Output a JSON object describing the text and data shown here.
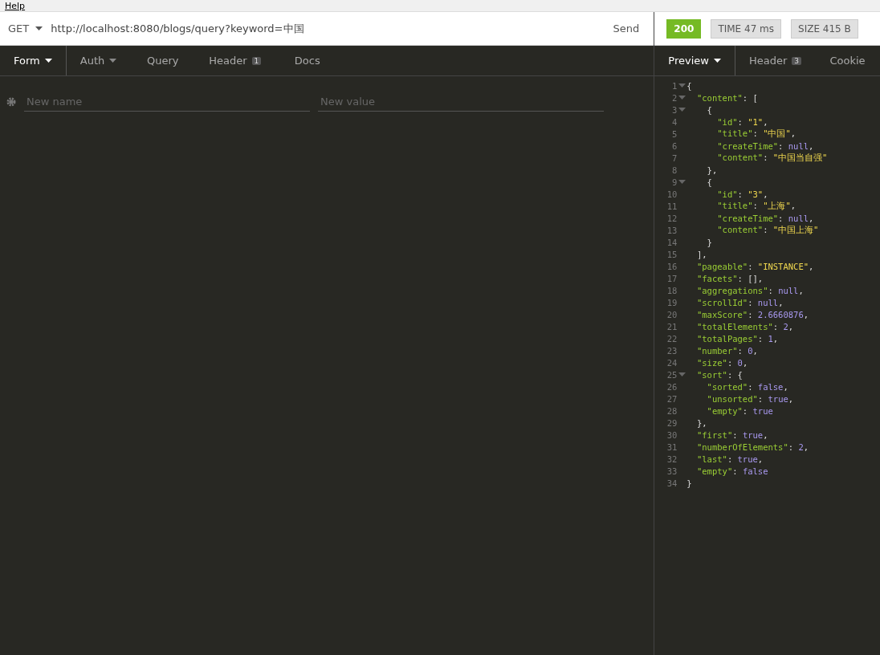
{
  "menu": {
    "label": "Help"
  },
  "request": {
    "method": "GET",
    "url": "http://localhost:8080/blogs/query?keyword=中国",
    "send": "Send"
  },
  "request_tabs": [
    {
      "label": "Form",
      "dropdown": true,
      "selected": true
    },
    {
      "label": "Auth",
      "dropdown": true,
      "selected": false
    },
    {
      "label": "Query",
      "dropdown": false,
      "selected": false
    },
    {
      "label": "Header",
      "dropdown": false,
      "badge": "1",
      "selected": false
    },
    {
      "label": "Docs",
      "dropdown": false,
      "selected": false
    }
  ],
  "form": {
    "name_placeholder": "New name",
    "value_placeholder": "New value"
  },
  "response": {
    "status": "200",
    "time": "TIME 47 ms",
    "size": "SIZE 415 B"
  },
  "response_tabs": [
    {
      "label": "Preview",
      "dropdown": true,
      "selected": true
    },
    {
      "label": "Header",
      "dropdown": false,
      "badge": "3",
      "selected": false
    },
    {
      "label": "Cookie",
      "dropdown": false,
      "selected": false
    }
  ],
  "code": [
    {
      "n": "1",
      "fold": true,
      "parts": [
        {
          "kind": "punct",
          "text": "{"
        }
      ]
    },
    {
      "n": "2",
      "fold": true,
      "parts": [
        {
          "kind": "key",
          "text": "  \"content\""
        },
        {
          "kind": "punct",
          "text": ": ["
        }
      ]
    },
    {
      "n": "3",
      "fold": true,
      "parts": [
        {
          "kind": "punct",
          "text": "    {"
        }
      ]
    },
    {
      "n": "4",
      "fold": false,
      "parts": [
        {
          "kind": "key",
          "text": "      \"id\""
        },
        {
          "kind": "punct",
          "text": ": "
        },
        {
          "kind": "string",
          "text": "\"1\""
        },
        {
          "kind": "punct",
          "text": ","
        }
      ]
    },
    {
      "n": "5",
      "fold": false,
      "parts": [
        {
          "kind": "key",
          "text": "      \"title\""
        },
        {
          "kind": "punct",
          "text": ": "
        },
        {
          "kind": "string",
          "text": "\"中国\""
        },
        {
          "kind": "punct",
          "text": ","
        }
      ]
    },
    {
      "n": "6",
      "fold": false,
      "parts": [
        {
          "kind": "key",
          "text": "      \"createTime\""
        },
        {
          "kind": "punct",
          "text": ": "
        },
        {
          "kind": "literal",
          "text": "null"
        },
        {
          "kind": "punct",
          "text": ","
        }
      ]
    },
    {
      "n": "7",
      "fold": false,
      "parts": [
        {
          "kind": "key",
          "text": "      \"content\""
        },
        {
          "kind": "punct",
          "text": ": "
        },
        {
          "kind": "string",
          "text": "\"中国当自强\""
        }
      ]
    },
    {
      "n": "8",
      "fold": false,
      "parts": [
        {
          "kind": "punct",
          "text": "    },"
        }
      ]
    },
    {
      "n": "9",
      "fold": true,
      "parts": [
        {
          "kind": "punct",
          "text": "    {"
        }
      ]
    },
    {
      "n": "10",
      "fold": false,
      "parts": [
        {
          "kind": "key",
          "text": "      \"id\""
        },
        {
          "kind": "punct",
          "text": ": "
        },
        {
          "kind": "string",
          "text": "\"3\""
        },
        {
          "kind": "punct",
          "text": ","
        }
      ]
    },
    {
      "n": "11",
      "fold": false,
      "parts": [
        {
          "kind": "key",
          "text": "      \"title\""
        },
        {
          "kind": "punct",
          "text": ": "
        },
        {
          "kind": "string",
          "text": "\"上海\""
        },
        {
          "kind": "punct",
          "text": ","
        }
      ]
    },
    {
      "n": "12",
      "fold": false,
      "parts": [
        {
          "kind": "key",
          "text": "      \"createTime\""
        },
        {
          "kind": "punct",
          "text": ": "
        },
        {
          "kind": "literal",
          "text": "null"
        },
        {
          "kind": "punct",
          "text": ","
        }
      ]
    },
    {
      "n": "13",
      "fold": false,
      "parts": [
        {
          "kind": "key",
          "text": "      \"content\""
        },
        {
          "kind": "punct",
          "text": ": "
        },
        {
          "kind": "string",
          "text": "\"中国上海\""
        }
      ]
    },
    {
      "n": "14",
      "fold": false,
      "parts": [
        {
          "kind": "punct",
          "text": "    }"
        }
      ]
    },
    {
      "n": "15",
      "fold": false,
      "parts": [
        {
          "kind": "punct",
          "text": "  ],"
        }
      ]
    },
    {
      "n": "16",
      "fold": false,
      "parts": [
        {
          "kind": "key",
          "text": "  \"pageable\""
        },
        {
          "kind": "punct",
          "text": ": "
        },
        {
          "kind": "string",
          "text": "\"INSTANCE\""
        },
        {
          "kind": "punct",
          "text": ","
        }
      ]
    },
    {
      "n": "17",
      "fold": false,
      "parts": [
        {
          "kind": "key",
          "text": "  \"facets\""
        },
        {
          "kind": "punct",
          "text": ": [],"
        }
      ]
    },
    {
      "n": "18",
      "fold": false,
      "parts": [
        {
          "kind": "key",
          "text": "  \"aggregations\""
        },
        {
          "kind": "punct",
          "text": ": "
        },
        {
          "kind": "literal",
          "text": "null"
        },
        {
          "kind": "punct",
          "text": ","
        }
      ]
    },
    {
      "n": "19",
      "fold": false,
      "parts": [
        {
          "kind": "key",
          "text": "  \"scrollId\""
        },
        {
          "kind": "punct",
          "text": ": "
        },
        {
          "kind": "literal",
          "text": "null"
        },
        {
          "kind": "punct",
          "text": ","
        }
      ]
    },
    {
      "n": "20",
      "fold": false,
      "parts": [
        {
          "kind": "key",
          "text": "  \"maxScore\""
        },
        {
          "kind": "punct",
          "text": ": "
        },
        {
          "kind": "literal",
          "text": "2.6660876"
        },
        {
          "kind": "punct",
          "text": ","
        }
      ]
    },
    {
      "n": "21",
      "fold": false,
      "parts": [
        {
          "kind": "key",
          "text": "  \"totalElements\""
        },
        {
          "kind": "punct",
          "text": ": "
        },
        {
          "kind": "literal",
          "text": "2"
        },
        {
          "kind": "punct",
          "text": ","
        }
      ]
    },
    {
      "n": "22",
      "fold": false,
      "parts": [
        {
          "kind": "key",
          "text": "  \"totalPages\""
        },
        {
          "kind": "punct",
          "text": ": "
        },
        {
          "kind": "literal",
          "text": "1"
        },
        {
          "kind": "punct",
          "text": ","
        }
      ]
    },
    {
      "n": "23",
      "fold": false,
      "parts": [
        {
          "kind": "key",
          "text": "  \"number\""
        },
        {
          "kind": "punct",
          "text": ": "
        },
        {
          "kind": "literal",
          "text": "0"
        },
        {
          "kind": "punct",
          "text": ","
        }
      ]
    },
    {
      "n": "24",
      "fold": false,
      "parts": [
        {
          "kind": "key",
          "text": "  \"size\""
        },
        {
          "kind": "punct",
          "text": ": "
        },
        {
          "kind": "literal",
          "text": "0"
        },
        {
          "kind": "punct",
          "text": ","
        }
      ]
    },
    {
      "n": "25",
      "fold": true,
      "parts": [
        {
          "kind": "key",
          "text": "  \"sort\""
        },
        {
          "kind": "punct",
          "text": ": {"
        }
      ]
    },
    {
      "n": "26",
      "fold": false,
      "parts": [
        {
          "kind": "key",
          "text": "    \"sorted\""
        },
        {
          "kind": "punct",
          "text": ": "
        },
        {
          "kind": "literal",
          "text": "false"
        },
        {
          "kind": "punct",
          "text": ","
        }
      ]
    },
    {
      "n": "27",
      "fold": false,
      "parts": [
        {
          "kind": "key",
          "text": "    \"unsorted\""
        },
        {
          "kind": "punct",
          "text": ": "
        },
        {
          "kind": "literal",
          "text": "true"
        },
        {
          "kind": "punct",
          "text": ","
        }
      ]
    },
    {
      "n": "28",
      "fold": false,
      "parts": [
        {
          "kind": "key",
          "text": "    \"empty\""
        },
        {
          "kind": "punct",
          "text": ": "
        },
        {
          "kind": "literal",
          "text": "true"
        }
      ]
    },
    {
      "n": "29",
      "fold": false,
      "parts": [
        {
          "kind": "punct",
          "text": "  },"
        }
      ]
    },
    {
      "n": "30",
      "fold": false,
      "parts": [
        {
          "kind": "key",
          "text": "  \"first\""
        },
        {
          "kind": "punct",
          "text": ": "
        },
        {
          "kind": "literal",
          "text": "true"
        },
        {
          "kind": "punct",
          "text": ","
        }
      ]
    },
    {
      "n": "31",
      "fold": false,
      "parts": [
        {
          "kind": "key",
          "text": "  \"numberOfElements\""
        },
        {
          "kind": "punct",
          "text": ": "
        },
        {
          "kind": "literal",
          "text": "2"
        },
        {
          "kind": "punct",
          "text": ","
        }
      ]
    },
    {
      "n": "32",
      "fold": false,
      "parts": [
        {
          "kind": "key",
          "text": "  \"last\""
        },
        {
          "kind": "punct",
          "text": ": "
        },
        {
          "kind": "literal",
          "text": "true"
        },
        {
          "kind": "punct",
          "text": ","
        }
      ]
    },
    {
      "n": "33",
      "fold": false,
      "parts": [
        {
          "kind": "key",
          "text": "  \"empty\""
        },
        {
          "kind": "punct",
          "text": ": "
        },
        {
          "kind": "literal",
          "text": "false"
        }
      ]
    },
    {
      "n": "34",
      "fold": false,
      "parts": [
        {
          "kind": "punct",
          "text": "}"
        }
      ]
    }
  ]
}
